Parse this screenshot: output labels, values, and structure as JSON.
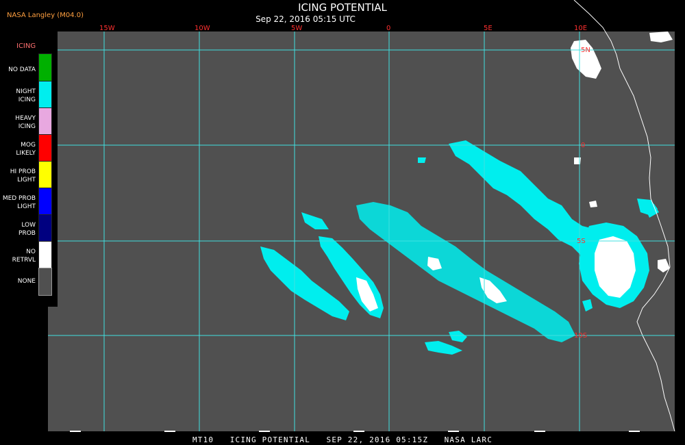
{
  "header": {
    "producer": "NASA Langley (M04.0)",
    "title": "ICING POTENTIAL",
    "datetime": "Sep 22, 2016 05:15 UTC"
  },
  "footer": {
    "caption": "MT10   ICING POTENTIAL   SEP 22, 2016 05:15Z   NASA LARC"
  },
  "legend": {
    "title": "ICING",
    "items": [
      {
        "label": "NO DATA",
        "color": "#00b000"
      },
      {
        "label": "NIGHT\nICING",
        "color": "#00eeee"
      },
      {
        "label": "HEAVY\nICING",
        "color": "#e8a8e0"
      },
      {
        "label": "MOG\nLIKELY",
        "color": "#ff0000"
      },
      {
        "label": "HI PROB\nLIGHT",
        "color": "#ffff00"
      },
      {
        "label": "MED PROB\nLIGHT",
        "color": "#0000ff"
      },
      {
        "label": "LOW\nPROB",
        "color": "#000080"
      },
      {
        "label": "NO\nRETRVL",
        "color": "#ffffff"
      },
      {
        "label": "NONE",
        "color": "#505050"
      }
    ]
  },
  "map": {
    "background_color": "#505050",
    "grid_color": "#40e0e0",
    "label_color": "#ff3030",
    "longitude_labels": [
      "15W",
      "10W",
      "5W",
      "0",
      "5E",
      "10E"
    ],
    "latitude_labels": [
      "5N",
      "0",
      "5S",
      "10S"
    ]
  }
}
